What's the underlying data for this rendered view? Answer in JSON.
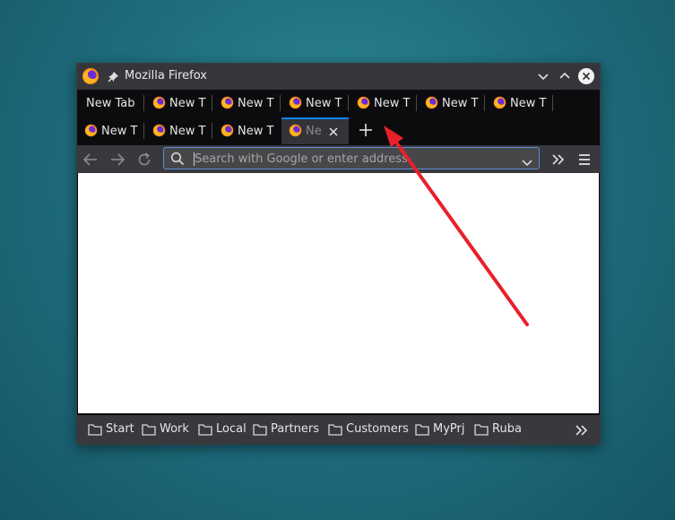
{
  "window": {
    "title": "Mozilla Firefox"
  },
  "tabs": {
    "row1": [
      "New Tab",
      "New T",
      "New T",
      "New T",
      "New T",
      "New T",
      "New T"
    ],
    "row2": [
      "New T",
      "New T",
      "New T",
      "Ne"
    ],
    "active_index": 10
  },
  "navbar": {
    "url_placeholder": "Search with Google or enter address",
    "url_value": ""
  },
  "bookmarks": [
    "Start",
    "Work",
    "Local",
    "Partners",
    "Customers",
    "MyPrj",
    "Ruba"
  ],
  "annotation": {
    "arrow_color": "#e8202a"
  },
  "colors": {
    "titlebar": "#36363a",
    "tabstrip": "#0c0c0e",
    "toolbar": "#38383d",
    "accent": "#0a84ff"
  },
  "icons": [
    "firefox-icon",
    "pin-icon",
    "minimize-icon",
    "maximize-icon",
    "close-window-icon",
    "close-tab-icon",
    "plus-icon",
    "back-icon",
    "forward-icon",
    "reload-icon",
    "search-icon",
    "chevron-down-icon",
    "overflow-icon",
    "menu-icon",
    "folder-icon"
  ]
}
